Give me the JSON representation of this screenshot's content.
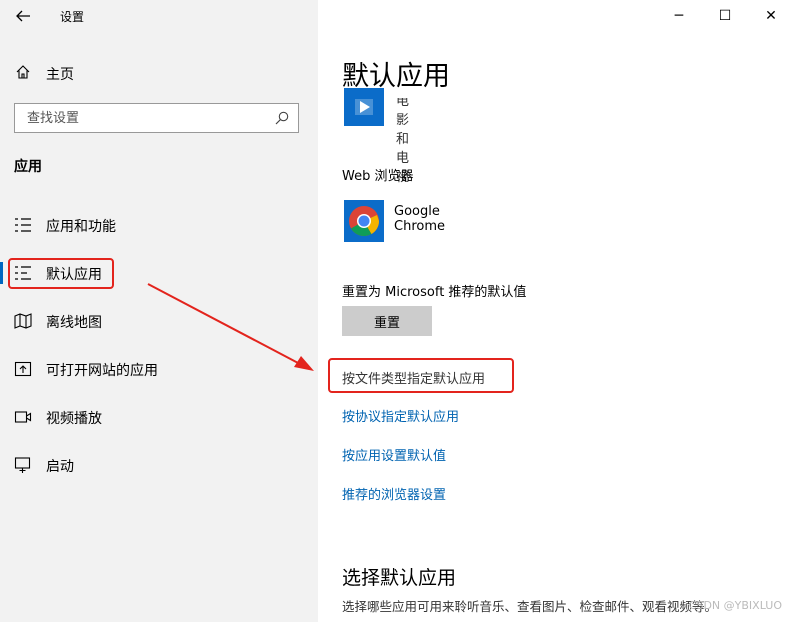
{
  "window": {
    "title": "设置",
    "back_icon": "arrow-left-icon",
    "controls": {
      "minimize": "─",
      "maximize": "☐",
      "close": "✕"
    }
  },
  "sidebar": {
    "home_label": "主页",
    "search_placeholder": "查找设置",
    "section_title": "应用",
    "items": [
      {
        "label": "应用和功能",
        "icon": "apps-features-icon"
      },
      {
        "label": "默认应用",
        "icon": "default-apps-icon",
        "selected": true
      },
      {
        "label": "离线地图",
        "icon": "offline-maps-icon"
      },
      {
        "label": "可打开网站的应用",
        "icon": "apps-for-websites-icon"
      },
      {
        "label": "视频播放",
        "icon": "video-playback-icon"
      },
      {
        "label": "启动",
        "icon": "startup-icon"
      }
    ]
  },
  "main": {
    "page_title": "默认应用",
    "movies_label": "电影和电视",
    "web_browser_heading": "Web 浏览器",
    "browser_name": "Google Chrome",
    "reset_heading": "重置为 Microsoft 推荐的默认值",
    "reset_button": "重置",
    "links": {
      "by_file_type": "按文件类型指定默认应用",
      "by_protocol": "按协议指定默认应用",
      "by_app": "按应用设置默认值",
      "recommended_browser": "推荐的浏览器设置"
    },
    "choose_title": "选择默认应用",
    "choose_desc": "选择哪些应用可用来聆听音乐、查看图片、检查邮件、观看视频等。"
  },
  "watermark": "CSDN @YBIXLUO",
  "colors": {
    "accent": "#0067c0",
    "link": "#0063b1",
    "annotation_red": "#e3241d",
    "sidebar_bg": "#f2f2f2"
  }
}
